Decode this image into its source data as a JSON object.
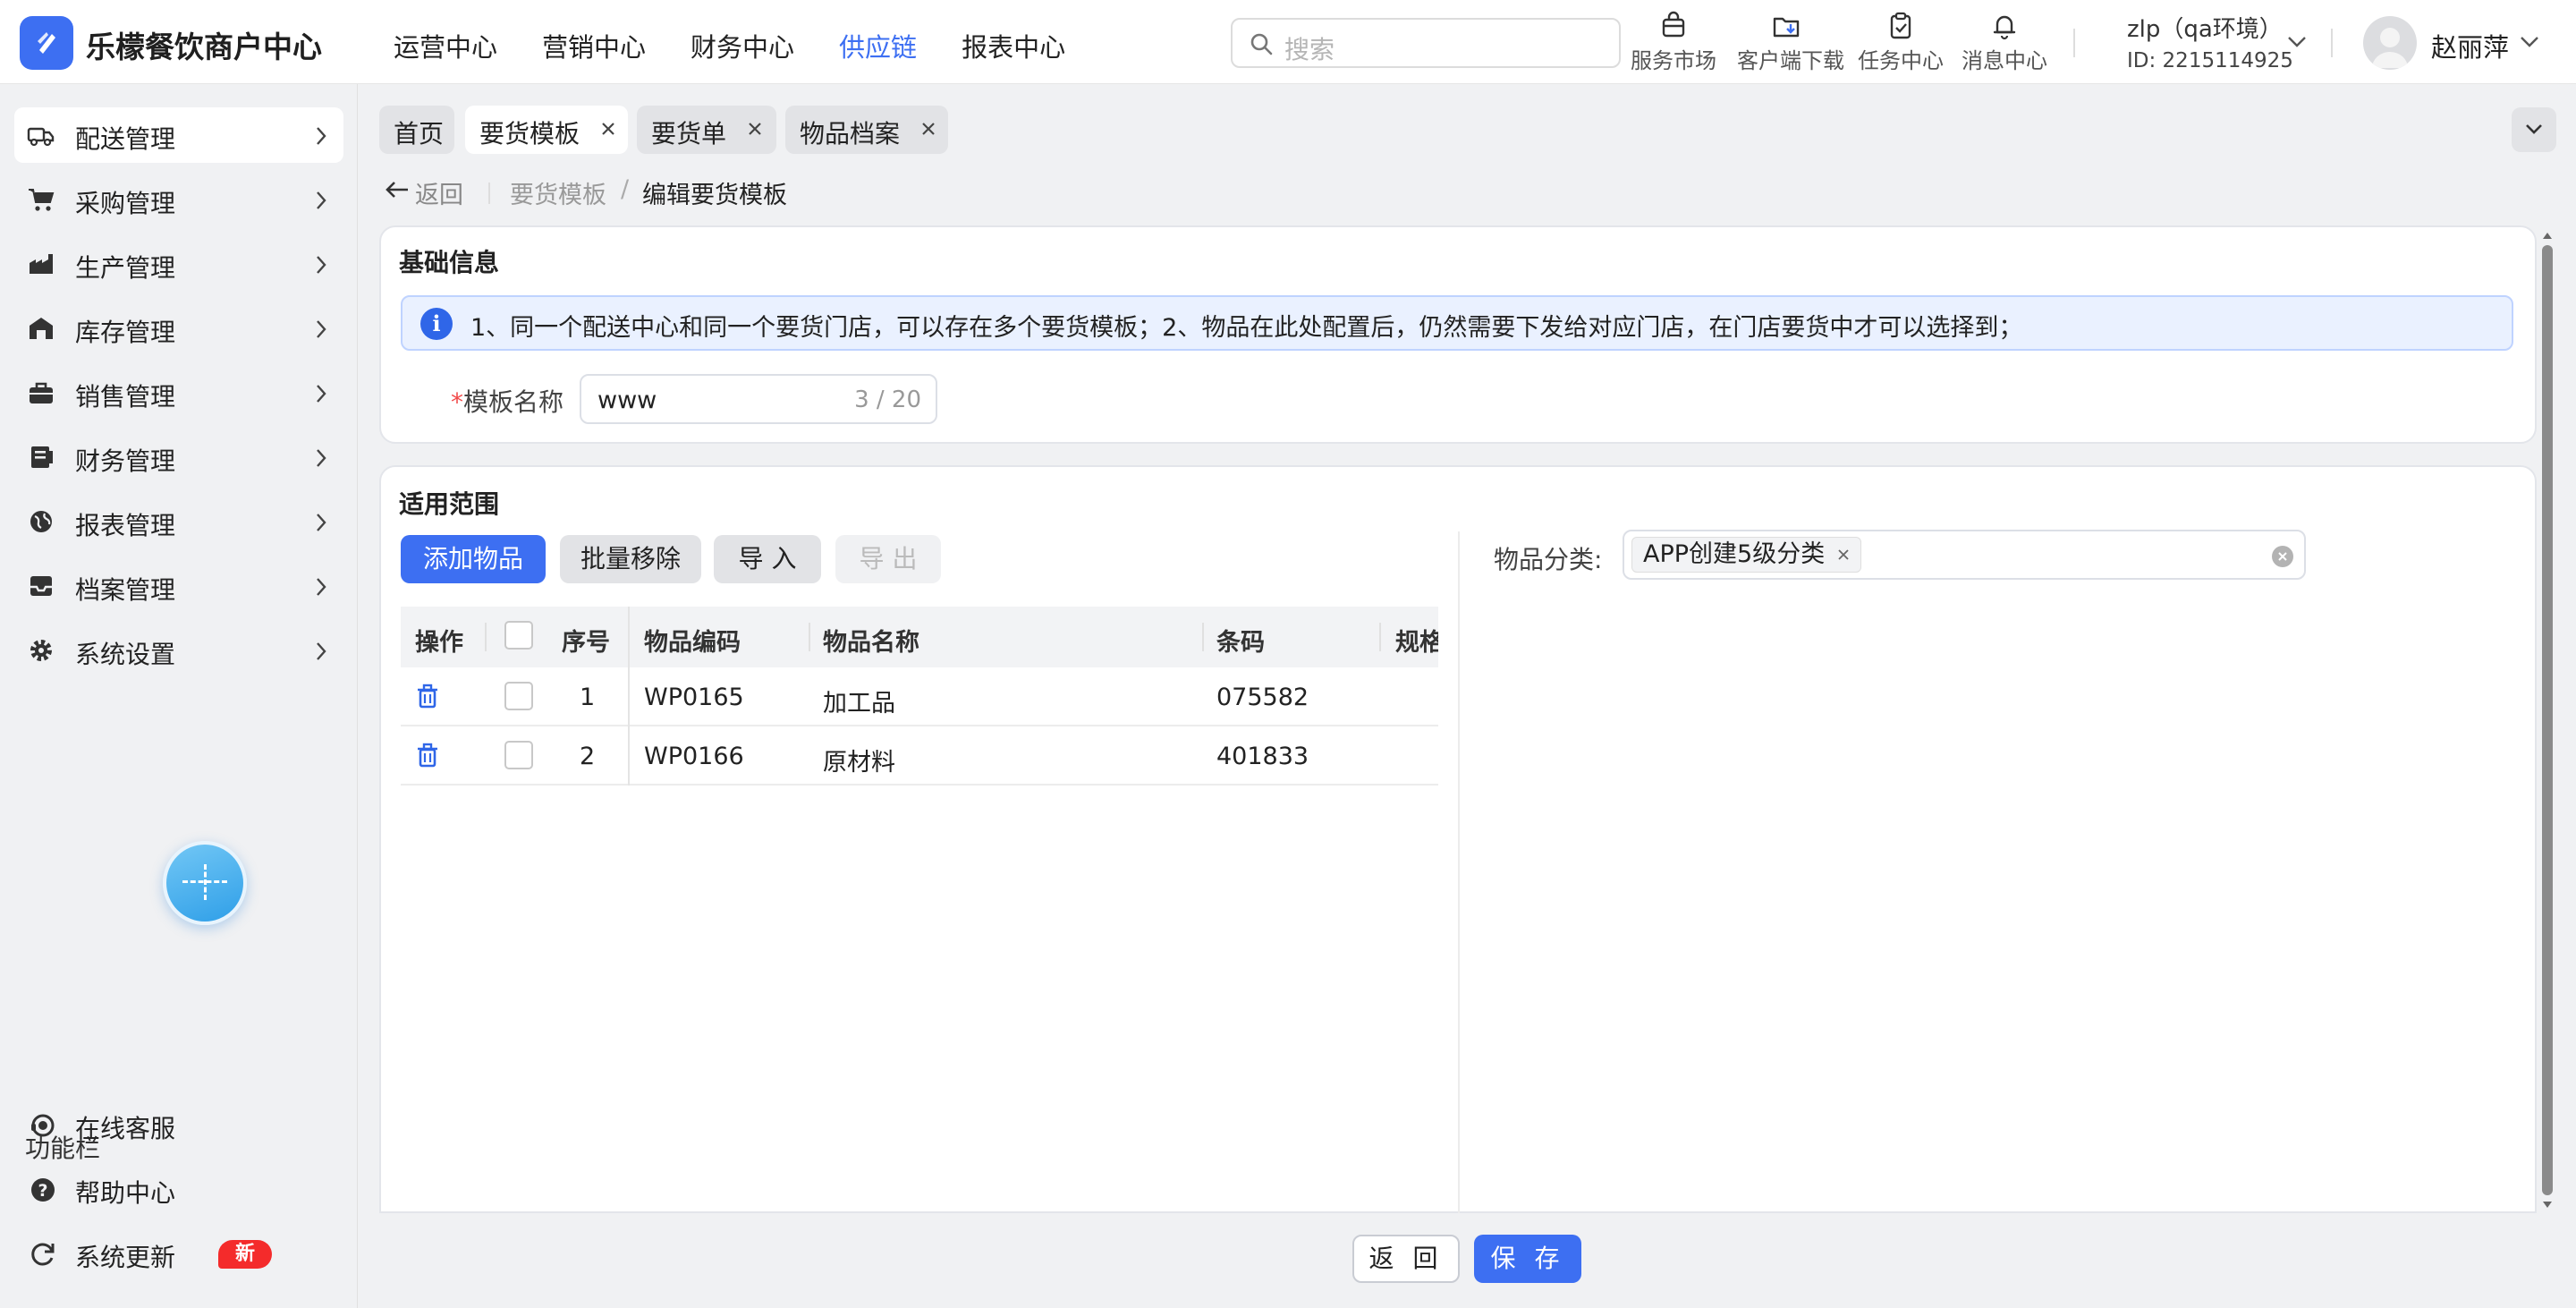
{
  "app": {
    "name": "乐檬餐饮商户中心",
    "brand_color": "#3d6ff2"
  },
  "topnav": [
    "运营中心",
    "营销中心",
    "财务中心",
    "供应链",
    "报表中心"
  ],
  "topnav_active": "供应链",
  "search": {
    "placeholder": "搜索",
    "icon": "search-icon"
  },
  "tools": [
    {
      "label": "服务市场",
      "icon": "market-bag-icon"
    },
    {
      "label": "客户端下载",
      "icon": "folder-download-icon"
    },
    {
      "label": "任务中心",
      "icon": "clipboard-check-icon"
    },
    {
      "label": "消息中心",
      "icon": "bell-icon"
    }
  ],
  "account": {
    "env": "zlp（qa环境）",
    "id": "ID: 2215114925",
    "username": "赵丽萍"
  },
  "sidebar": {
    "items": [
      {
        "label": "配送管理",
        "icon": "truck-icon"
      },
      {
        "label": "采购管理",
        "icon": "cart-icon"
      },
      {
        "label": "生产管理",
        "icon": "factory-icon"
      },
      {
        "label": "库存管理",
        "icon": "warehouse-icon"
      },
      {
        "label": "销售管理",
        "icon": "briefcase-icon"
      },
      {
        "label": "财务管理",
        "icon": "ledger-icon"
      },
      {
        "label": "报表管理",
        "icon": "globe-icon"
      },
      {
        "label": "档案管理",
        "icon": "inbox-icon"
      },
      {
        "label": "系统设置",
        "icon": "gear-icon"
      }
    ],
    "active": "配送管理",
    "func_title": "功能栏",
    "func_items": [
      {
        "label": "在线客服",
        "icon": "headset-icon"
      },
      {
        "label": "帮助中心",
        "icon": "help-icon"
      },
      {
        "label": "系统更新",
        "icon": "refresh-icon",
        "badge": "新"
      }
    ]
  },
  "tabs": [
    {
      "label": "首页",
      "closable": false
    },
    {
      "label": "要货模板",
      "closable": true,
      "active": true
    },
    {
      "label": "要货单",
      "closable": true
    },
    {
      "label": "物品档案",
      "closable": true
    }
  ],
  "breadcrumb": {
    "back": "返回",
    "parent": "要货模板",
    "separator": "/",
    "current": "编辑要货模板"
  },
  "basic_info": {
    "title": "基础信息",
    "notice": "1、同一个配送中心和同一个要货门店，可以存在多个要货模板；2、物品在此处配置后，仍然需要下发给对应门店，在门店要货中才可以选择到；",
    "template_name_label": "模板名称",
    "required_mark": "*",
    "template_name_value": "www",
    "template_name_count": "3 / 20"
  },
  "scope": {
    "title": "适用范围",
    "buttons": {
      "add": "添加物品",
      "batch_remove": "批量移除",
      "import": "导 入",
      "export": "导 出"
    },
    "columns": [
      "操作",
      "序号",
      "物品编码",
      "物品名称",
      "条码",
      "规格"
    ],
    "rows": [
      {
        "index": "1",
        "code": "WP0165",
        "name": "加工品",
        "barcode": "075582"
      },
      {
        "index": "2",
        "code": "WP0166",
        "name": "原材料",
        "barcode": "401833"
      }
    ],
    "category_label": "物品分类:",
    "category_chip": "APP创建5级分类"
  },
  "footer": {
    "back": "返 回",
    "save": "保 存"
  }
}
